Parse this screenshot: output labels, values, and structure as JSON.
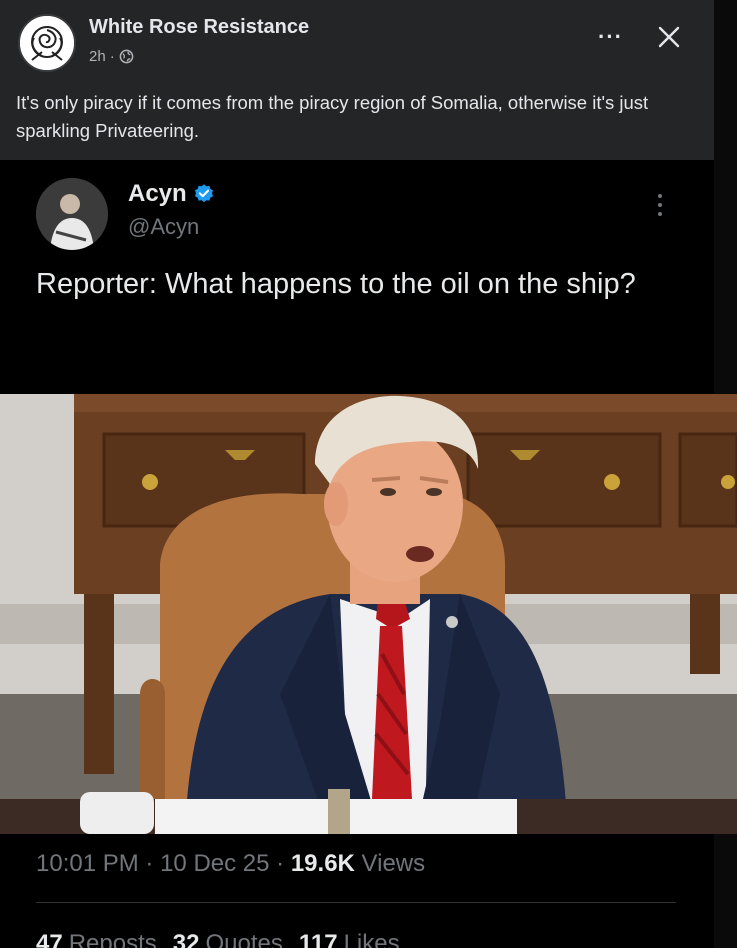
{
  "fb_post": {
    "author": "White Rose Resistance",
    "time": "2h",
    "separator": "·",
    "more_label": "···",
    "text": "It's only piracy if it comes from the piracy region of Somalia, otherwise it's just sparkling Privateering.",
    "icons": {
      "avatar": "white-rose-logo",
      "audience": "globe-icon",
      "close": "close-icon"
    }
  },
  "tweet": {
    "name": "Acyn",
    "handle": "@Acyn",
    "text": "Reporter: What happens to the oil on the ship?",
    "time": "10:01 PM",
    "date": "10 Dec 25",
    "views_count": "19.6K",
    "views_label": "Views",
    "dot": "·",
    "stats": {
      "reposts_count": "47",
      "reposts_label": "Reposts",
      "quotes_count": "32",
      "quotes_label": "Quotes",
      "likes_count": "117",
      "likes_label": "Likes"
    },
    "icons": {
      "verified": "verified-badge-icon",
      "more": "more-vertical-icon"
    },
    "colors": {
      "verified": "#1d9bf0",
      "muted": "#71767b",
      "text": "#e7e9ea"
    }
  },
  "colors": {
    "fb_background": "#242526",
    "tweet_background": "#000000"
  }
}
